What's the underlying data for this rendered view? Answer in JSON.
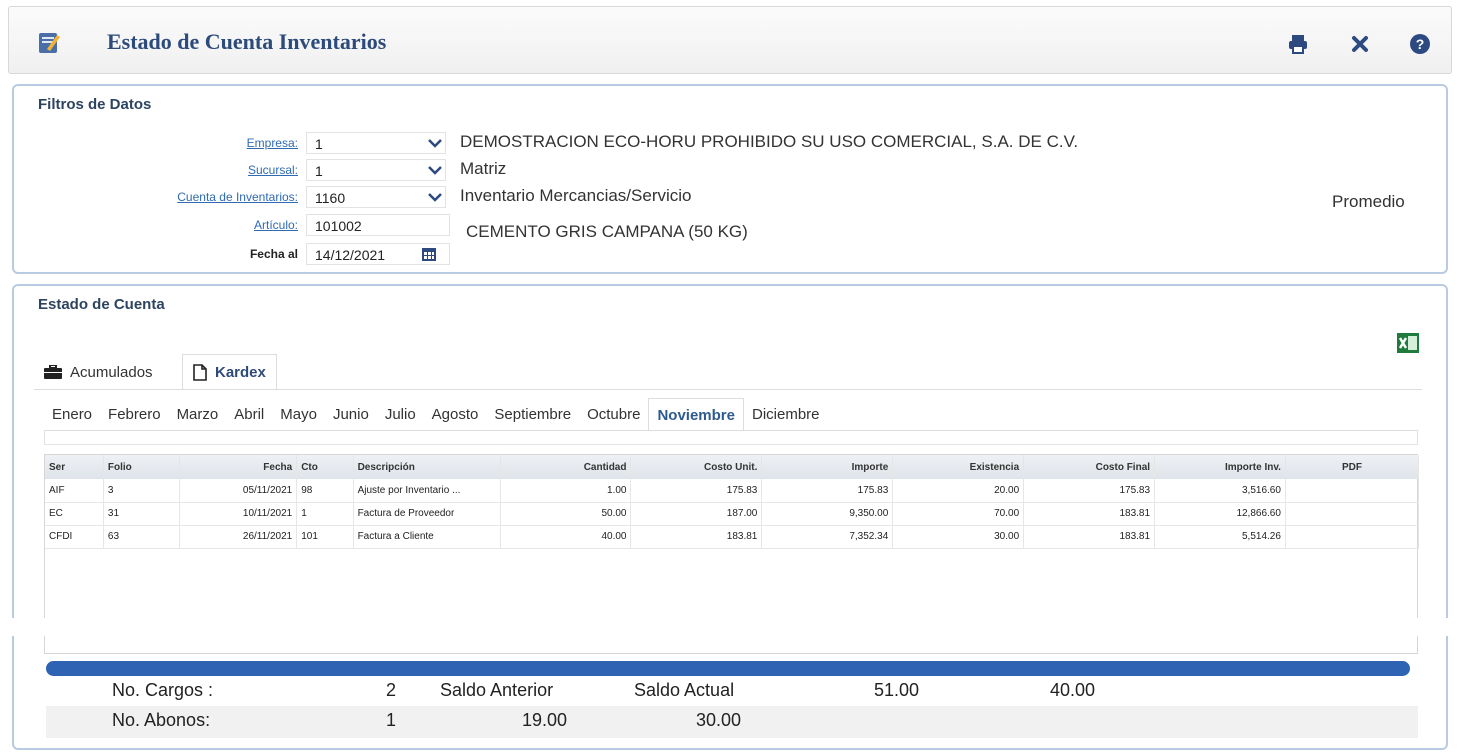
{
  "app": {
    "title": "Estado de Cuenta Inventarios"
  },
  "toolbar": {
    "print_icon": "print-icon",
    "close_icon": "close-icon",
    "help_icon": "help-icon"
  },
  "filters": {
    "title": "Filtros de Datos",
    "empresa_label": "Empresa:",
    "empresa_value": "1",
    "empresa_desc": "DEMOSTRACION ECO-HORU PROHIBIDO SU USO COMERCIAL, S.A. DE C.V.",
    "sucursal_label": "Sucursal:",
    "sucursal_value": "1",
    "sucursal_desc": "Matriz",
    "cuenta_label": "Cuenta de Inventarios:",
    "cuenta_value": "1160",
    "cuenta_desc": "Inventario Mercancias/Servicio",
    "articulo_label": "Artículo:",
    "articulo_value": "101002",
    "articulo_desc": "CEMENTO GRIS CAMPANA (50 KG)",
    "fecha_label": "Fecha al",
    "fecha_value": "14/12/2021",
    "method": "Promedio"
  },
  "estado": {
    "title": "Estado de Cuenta",
    "tabs": [
      {
        "label": "Acumulados",
        "active": false
      },
      {
        "label": "Kardex",
        "active": true
      }
    ],
    "months": [
      "Enero",
      "Febrero",
      "Marzo",
      "Abril",
      "Mayo",
      "Junio",
      "Julio",
      "Agosto",
      "Septiembre",
      "Octubre",
      "Noviembre",
      "Diciembre"
    ],
    "active_month": "Noviembre"
  },
  "grid": {
    "columns": [
      "Ser",
      "Folio",
      "Fecha",
      "Cto",
      "Descripción",
      "Cantidad",
      "Costo Unit.",
      "Importe",
      "Existencia",
      "Costo Final",
      "Importe Inv.",
      "PDF"
    ],
    "rows": [
      [
        "AIF",
        "3",
        "05/11/2021",
        "98",
        "Ajuste por Inventario ...",
        "1.00",
        "175.83",
        "175.83",
        "20.00",
        "175.83",
        "3,516.60",
        ""
      ],
      [
        "EC",
        "31",
        "10/11/2021",
        "1",
        "Factura de Proveedor",
        "50.00",
        "187.00",
        "9,350.00",
        "70.00",
        "183.81",
        "12,866.60",
        ""
      ],
      [
        "CFDI",
        "63",
        "26/11/2021",
        "101",
        "Factura a Cliente",
        "40.00",
        "183.81",
        "7,352.34",
        "30.00",
        "183.81",
        "5,514.26",
        ""
      ]
    ]
  },
  "summary": {
    "cargos_label": "No. Cargos :",
    "cargos_value": "2",
    "saldo_anterior_label": "Saldo Anterior",
    "saldo_actual_label": "Saldo Actual",
    "val_51": "51.00",
    "val_40": "40.00",
    "abonos_label": "No. Abonos:",
    "abonos_value": "1",
    "saldo_anterior_value": "19.00",
    "saldo_actual_value": "30.00"
  },
  "colors": {
    "accent": "#2f5a8f",
    "progress": "#2e63b4",
    "link": "#2f6bb3"
  }
}
